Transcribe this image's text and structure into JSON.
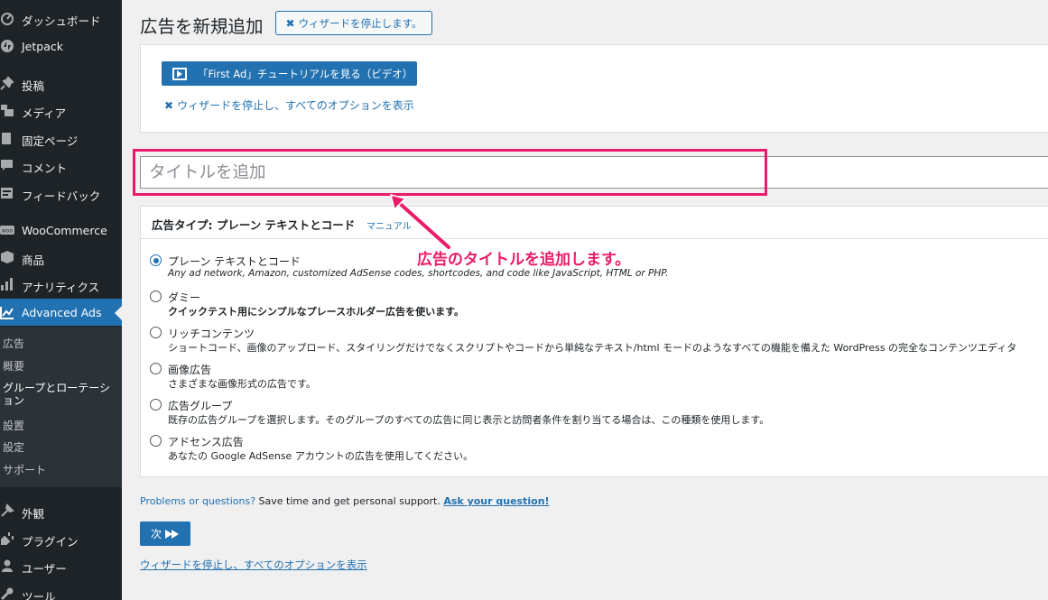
{
  "sidebar": {
    "items": [
      {
        "label": "ダッシュボード",
        "icon": "dashboard-icon"
      },
      {
        "label": "Jetpack",
        "icon": "jetpack-icon"
      },
      {
        "label": "投稿",
        "icon": "pushpin-icon"
      },
      {
        "label": "メディア",
        "icon": "media-icon"
      },
      {
        "label": "固定ページ",
        "icon": "page-icon"
      },
      {
        "label": "コメント",
        "icon": "comment-icon"
      },
      {
        "label": "フィードバック",
        "icon": "feedback-icon"
      },
      {
        "label": "WooCommerce",
        "icon": "woo-icon"
      },
      {
        "label": "商品",
        "icon": "box-icon"
      },
      {
        "label": "アナリティクス",
        "icon": "bar-chart-icon"
      },
      {
        "label": "Advanced Ads",
        "icon": "advanced-ads-icon"
      },
      {
        "label": "外観",
        "icon": "appearance-icon"
      },
      {
        "label": "プラグイン",
        "icon": "plugin-icon"
      },
      {
        "label": "ユーザー",
        "icon": "user-icon"
      },
      {
        "label": "ツール",
        "icon": "tools-icon"
      }
    ],
    "submenu": [
      "広告",
      "概要",
      "グループとローテーション",
      "設置",
      "設定",
      "サポート"
    ]
  },
  "header": {
    "title": "広告を新規追加",
    "stop_wizard_label": "ウィザードを停止します。"
  },
  "tutorial": {
    "button_label": "「First Ad」チュートリアルを見る（ビデオ）",
    "stop_link_label": "ウィザードを停止し、すべてのオプションを表示"
  },
  "title_field": {
    "placeholder": "タイトルを追加",
    "value": ""
  },
  "annotation": {
    "text": "広告のタイトルを追加します。"
  },
  "ad_type": {
    "heading": "広告タイプ: プレーン テキストとコード",
    "manual_label": "マニュアル",
    "options": [
      {
        "label": "プレーン テキストとコード",
        "desc": "Any ad network, Amazon, customized AdSense codes, shortcodes, and code like JavaScript, HTML or PHP.",
        "checked": true
      },
      {
        "label": "ダミー",
        "desc": "クイックテスト用にシンプルなプレースホルダー広告を使います。",
        "checked": false
      },
      {
        "label": "リッチコンテンツ",
        "desc": "ショートコード、画像のアップロード、スタイリングだけでなくスクリプトやコードから単純なテキスト/html モードのようなすべての機能を備えた WordPress の完全なコンテンツエディタ",
        "checked": false
      },
      {
        "label": "画像広告",
        "desc": "さまざまな画像形式の広告です。",
        "checked": false
      },
      {
        "label": "広告グループ",
        "desc": "既存の広告グループを選択します。そのグループのすべての広告に同じ表示と訪問者条件を割り当てる場合は、この種類を使用します。",
        "checked": false
      },
      {
        "label": "アドセンス広告",
        "desc": "あなたの Google AdSense アカウントの広告を使用してください。",
        "checked": false
      }
    ]
  },
  "support": {
    "question": "Problems or questions?",
    "text": " Save time and get personal support. ",
    "link": "Ask your question!"
  },
  "footer": {
    "next_label": "次",
    "stop_link_label": "ウィザードを停止し、すべてのオプションを表示"
  },
  "colors": {
    "sidebar_bg": "#1d2327",
    "accent": "#2271b1",
    "highlight": "#ec1b6a"
  }
}
